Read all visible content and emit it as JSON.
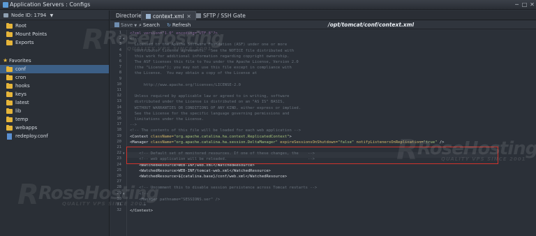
{
  "window": {
    "title": "Application Servers : Configs",
    "controls": [
      "─",
      "□",
      "✕"
    ]
  },
  "sidebar": {
    "node_label": "Node ID: 1794",
    "root_items": [
      {
        "label": "Root",
        "icon": "folder-icon",
        "selected": false
      },
      {
        "label": "Mount Points",
        "icon": "folder-icon",
        "selected": false
      },
      {
        "label": "Exports",
        "icon": "folder-icon",
        "selected": false
      }
    ],
    "favorites_label": "Favorites",
    "favorites": [
      {
        "label": "conf",
        "icon": "folder-icon",
        "selected": true
      },
      {
        "label": "cron",
        "icon": "folder-icon",
        "selected": false
      },
      {
        "label": "hooks",
        "icon": "folder-icon",
        "selected": false
      },
      {
        "label": "keys",
        "icon": "folder-icon",
        "selected": false
      },
      {
        "label": "latest",
        "icon": "folder-icon",
        "selected": false
      },
      {
        "label": "lib",
        "icon": "folder-icon",
        "selected": false
      },
      {
        "label": "temp",
        "icon": "folder-icon",
        "selected": false
      },
      {
        "label": "webapps",
        "icon": "folder-icon",
        "selected": false
      },
      {
        "label": "redeploy.conf",
        "icon": "file-icon",
        "selected": false
      }
    ]
  },
  "tabs": [
    {
      "label": "Directories",
      "active": false
    },
    {
      "label": "context.xml",
      "active": true
    },
    {
      "label": "SFTP / SSH Gate",
      "active": false
    }
  ],
  "toolbar": {
    "save_label": "Save",
    "search_label": "Search",
    "refresh_label": "Refresh",
    "path": "/opt/tomcat/conf/context.xml"
  },
  "editor": {
    "lines": [
      {
        "n": "1",
        "text": "<?xml version=\"1.0\" encoding=\"UTF-8\"?>",
        "kind": "pi"
      },
      {
        "n": "2",
        "text": "<!--",
        "kind": "cm",
        "fold": true
      },
      {
        "n": "3",
        "text": "  Licensed to the Apache Software Foundation (ASF) under one or more",
        "kind": "cm"
      },
      {
        "n": "4",
        "text": "  contributor license agreements.  See the NOTICE file distributed with",
        "kind": "cm"
      },
      {
        "n": "5",
        "text": "  this work for additional information regarding copyright ownership.",
        "kind": "cm"
      },
      {
        "n": "6",
        "text": "  The ASF licenses this file to You under the Apache License, Version 2.0",
        "kind": "cm"
      },
      {
        "n": "7",
        "text": "  (the \"License\"); you may not use this file except in compliance with",
        "kind": "cm"
      },
      {
        "n": "8",
        "text": "  the License.  You may obtain a copy of the License at",
        "kind": "cm"
      },
      {
        "n": "9",
        "text": "",
        "kind": "cm"
      },
      {
        "n": "10",
        "text": "      http://www.apache.org/licenses/LICENSE-2.0",
        "kind": "cm"
      },
      {
        "n": "11",
        "text": "",
        "kind": "cm"
      },
      {
        "n": "12",
        "text": "  Unless required by applicable law or agreed to in writing, software",
        "kind": "cm"
      },
      {
        "n": "13",
        "text": "  distributed under the License is distributed on an \"AS IS\" BASIS,",
        "kind": "cm"
      },
      {
        "n": "14",
        "text": "  WITHOUT WARRANTIES OR CONDITIONS OF ANY KIND, either express or implied.",
        "kind": "cm"
      },
      {
        "n": "15",
        "text": "  See the License for the specific language governing permissions and",
        "kind": "cm"
      },
      {
        "n": "16",
        "text": "  limitations under the License.",
        "kind": "cm"
      },
      {
        "n": "17",
        "text": "-->",
        "kind": "cm"
      },
      {
        "n": "18",
        "text": "<!-- The contents of this file will be loaded for each web application -->",
        "kind": "cm"
      },
      {
        "n": "19",
        "kind": "ctx1"
      },
      {
        "n": "20",
        "kind": "ctx2"
      },
      {
        "n": "21",
        "text": "",
        "kind": "cm"
      },
      {
        "n": "22",
        "text": "    <!-- Default set of monitored resources. If one of these changes, the    -->",
        "kind": "cm",
        "fold": true
      },
      {
        "n": "23",
        "text": "    <!-- web application will be reloaded.                                   -->",
        "kind": "cm"
      },
      {
        "n": "24",
        "text": "    <WatchedResource>WEB-INF/web.xml</WatchedResource>",
        "kind": "tag"
      },
      {
        "n": "25",
        "text": "    <WatchedResource>WEB-INF/tomcat-web.xml</WatchedResource>",
        "kind": "tag"
      },
      {
        "n": "26",
        "text": "    <WatchedResource>${catalina.base}/conf/web.xml</WatchedResource>",
        "kind": "tag"
      },
      {
        "n": "27",
        "text": "",
        "kind": "cm"
      },
      {
        "n": "28",
        "text": "    <!-- Uncomment this to disable session persistence across Tomcat restarts -->",
        "kind": "cm"
      },
      {
        "n": "29",
        "text": "    <!--",
        "kind": "cm",
        "fold": true
      },
      {
        "n": "30",
        "text": "    <Manager pathname=\"SESSIONS.ser\" />",
        "kind": "cm"
      },
      {
        "n": "31",
        "text": "    -->",
        "kind": "cm"
      },
      {
        "n": "32",
        "text": "</Context>",
        "kind": "tag"
      }
    ],
    "context_line": {
      "open": "<Context ",
      "attr": "className=",
      "val": "\"org.apache.catalina.ha.context.ReplicatedContext\"",
      "close": ">"
    },
    "manager_line": {
      "open": "<Manager ",
      "attr1": "className=",
      "val1": "\"org.apache.catalina.ha.session.DeltaManager\"",
      "attr2": " expireSessionsOnShutdown=",
      "val2": "\"false\"",
      "attr3": " notifyListenersOnReplication=",
      "val3": "\"true\"",
      "close": " />"
    }
  },
  "watermark": {
    "brand": "RoseHosting",
    "tagline": "QUALITY VPS SINCE 2001",
    "letter": "R"
  }
}
